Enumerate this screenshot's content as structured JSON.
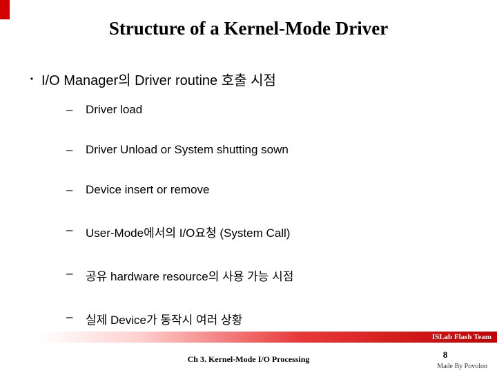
{
  "title": "Structure of a Kernel-Mode Driver",
  "bullet": {
    "marker": "•",
    "text": "I/O Manager의 Driver routine 호출 시점"
  },
  "sub": {
    "marker": "–",
    "items": [
      "Driver load",
      "Driver Unload or System shutting sown",
      "Device insert or remove",
      "User-Mode에서의 I/O요청 (System Call)",
      "공유 hardware resource의 사용 가능 시점",
      "실제 Device가 동작시 여러 상황"
    ]
  },
  "footer": {
    "team": "ISLab Flash Team",
    "chapter": "Ch 3. Kernel-Mode I/O Processing",
    "page": "8",
    "author": "Made By Povolon"
  }
}
